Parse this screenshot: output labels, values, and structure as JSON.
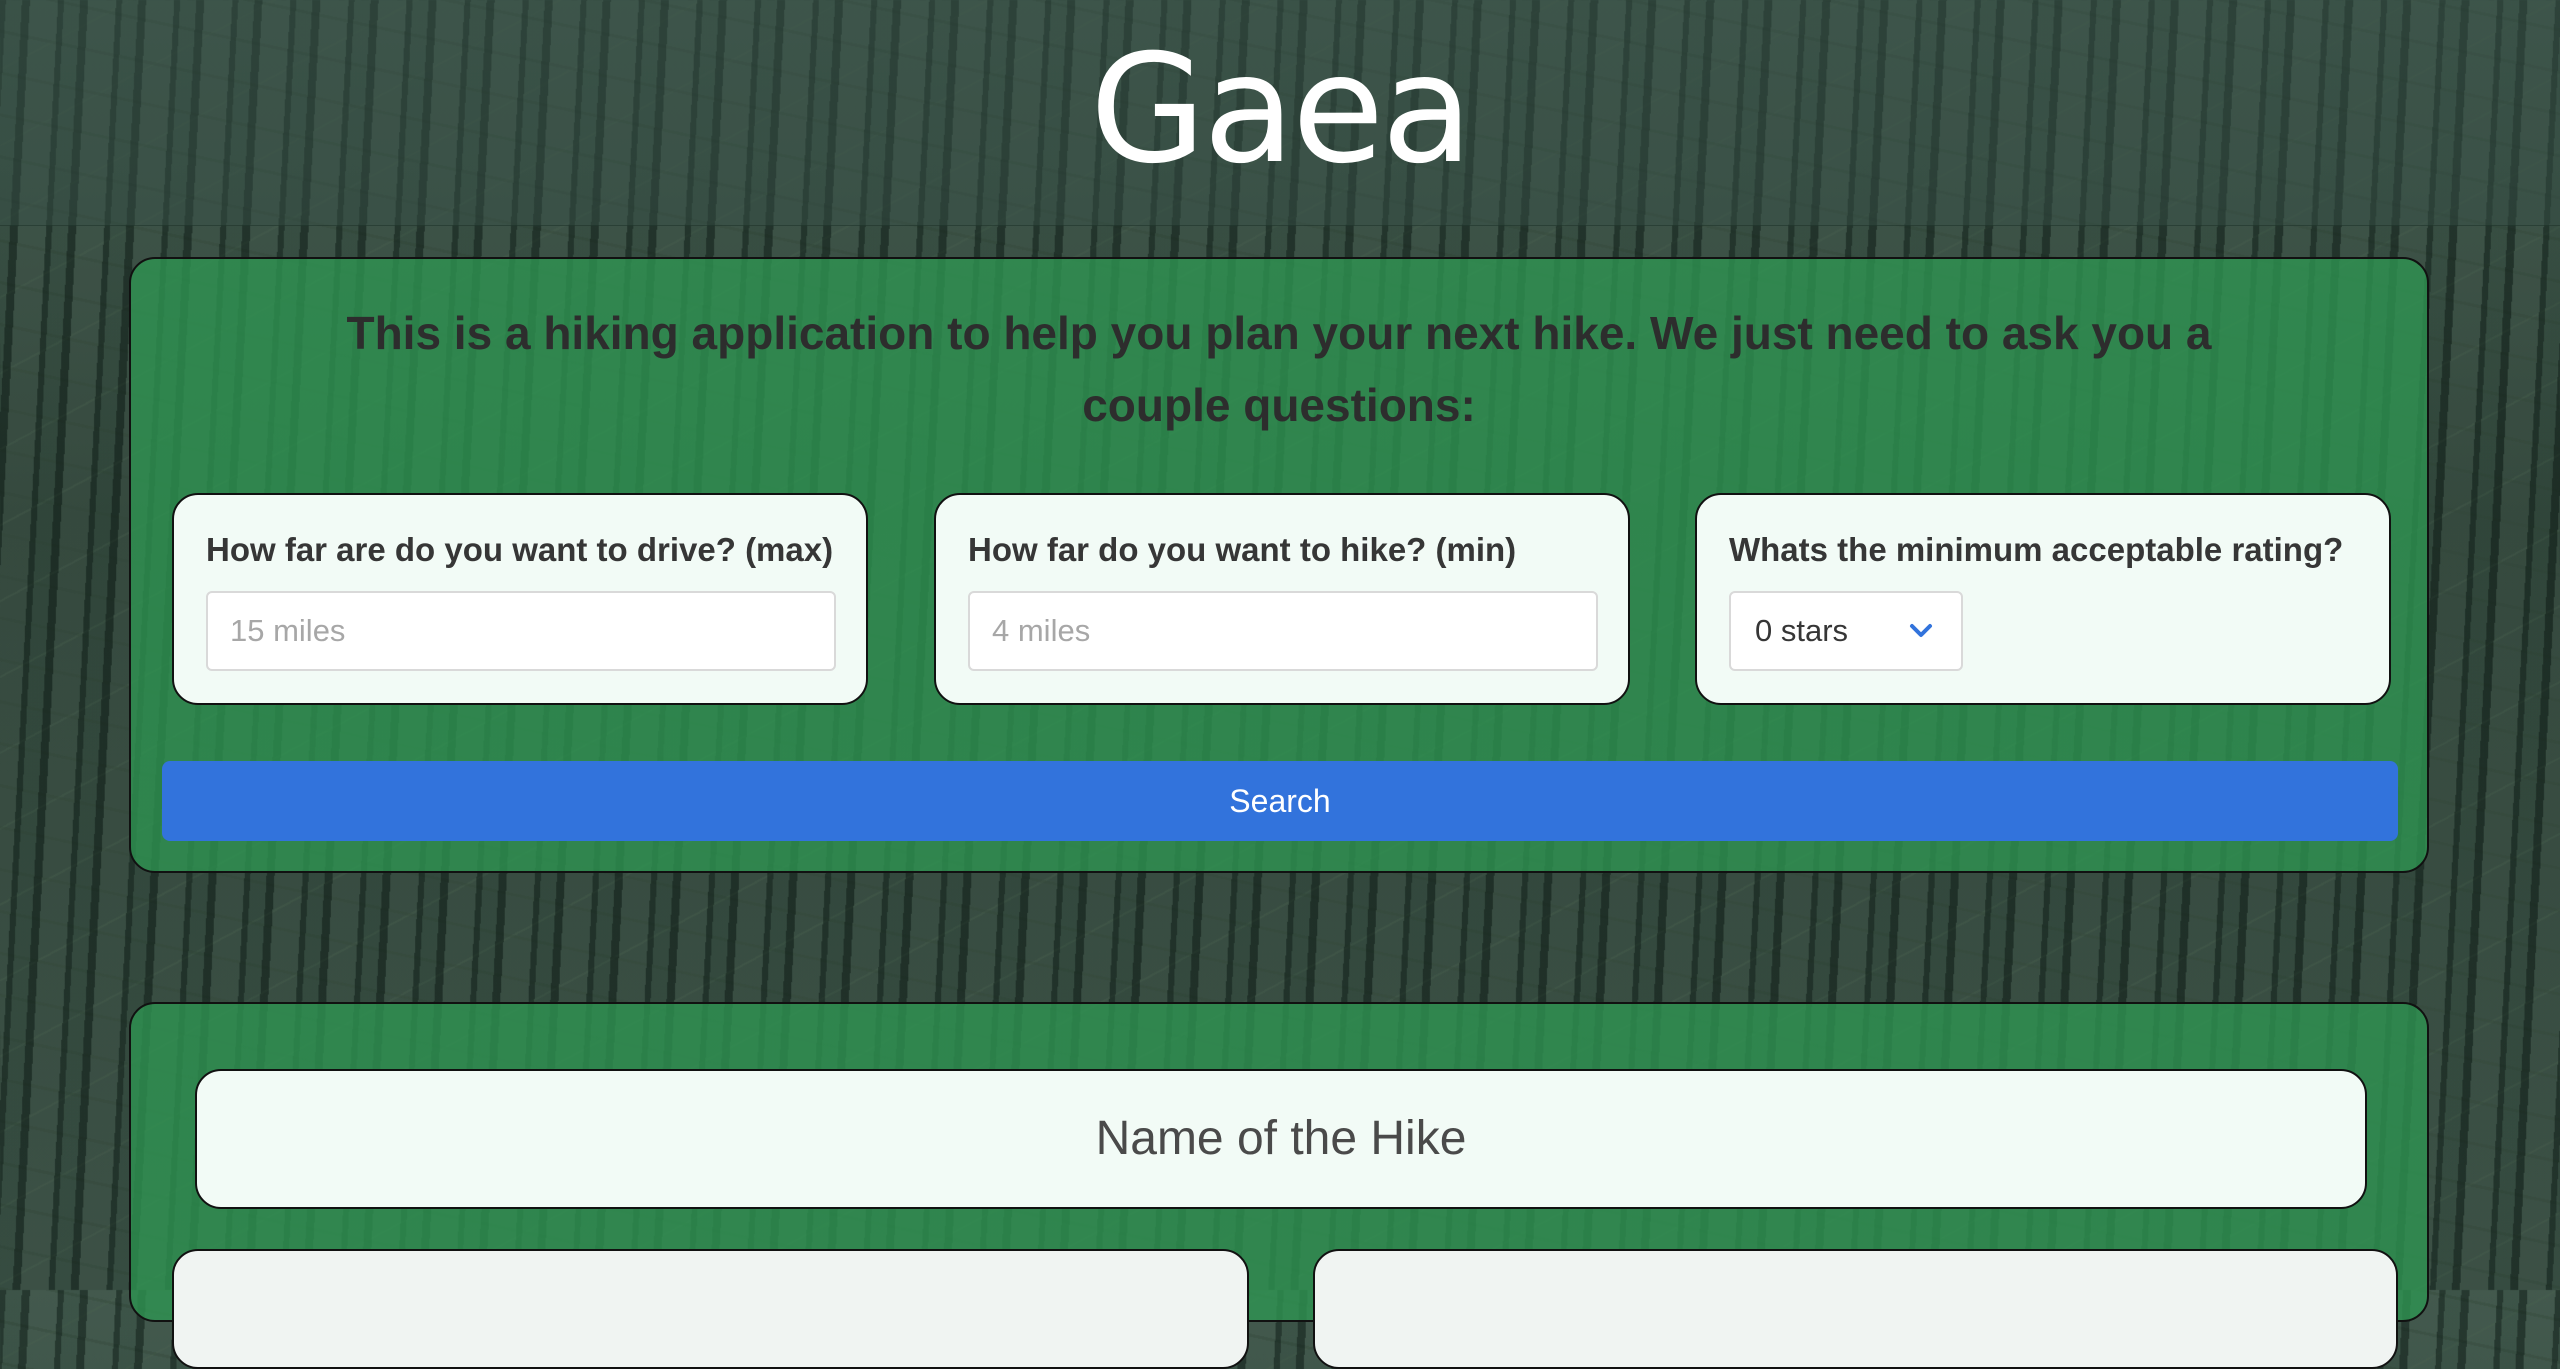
{
  "header": {
    "title": "Gaea"
  },
  "intro": "This is a hiking application to help you plan your next hike. We just need to ask you a couple questions:",
  "questions": {
    "drive": {
      "label": "How far are do you want to drive? (max)",
      "placeholder": "15 miles"
    },
    "hike": {
      "label": "How far do you want to hike? (min)",
      "placeholder": "4 miles"
    },
    "rating": {
      "label": "Whats the minimum acceptable rating?",
      "selected": "0 stars"
    }
  },
  "search_button": "Search",
  "result": {
    "name": "Name of the Hike"
  },
  "colors": {
    "panel": "#2e9652",
    "card": "#f2fbf6",
    "button": "#3273dc",
    "header_text": "#ffffff"
  },
  "icons": {
    "select": "chevron-down-icon"
  }
}
